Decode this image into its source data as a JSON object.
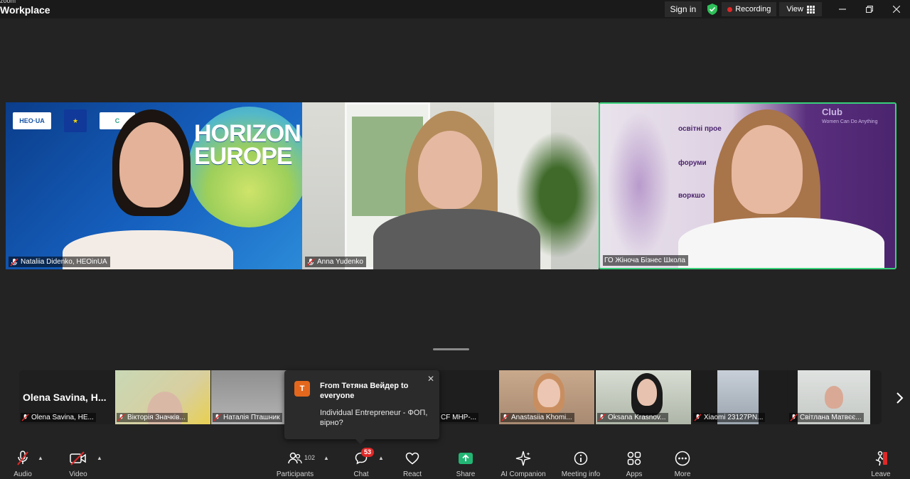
{
  "app": {
    "brand_top": "zoom",
    "brand_name": "Workplace"
  },
  "titlebar": {
    "sign_in": "Sign in",
    "recording": "Recording",
    "view": "View"
  },
  "main_tiles": [
    {
      "name": "Nataliia Didenko, HEOinUA",
      "logo_text": "HEO·UA",
      "graphic_text": "HORIZON EUROPE"
    },
    {
      "name": "Anna Yudenko"
    },
    {
      "name": "ГО Жіноча Бізнес Школа",
      "background_text": [
        "освітні прое",
        "форуми",
        "воркшо",
        "Club",
        "Women Can Do Anything"
      ]
    }
  ],
  "thumbnails": [
    {
      "name": "Olena Savina, HE...",
      "big_text": "Olena Savina, H..."
    },
    {
      "name": "Вікторія Значків..."
    },
    {
      "name": "Наталія Пташник"
    },
    {
      "name": "CF МНР-..."
    },
    {
      "name": "Anastasiia Khomi..."
    },
    {
      "name": "Oksana Krasnov..."
    },
    {
      "name": "Xiaomi 23127PN..."
    },
    {
      "name": "Світлана Матвєє..."
    }
  ],
  "chat_popup": {
    "avatar_letter": "T",
    "from": "From Тетяна Вейдер to everyone",
    "message": "Individual Entrepreneur - ФОП, вірно?"
  },
  "toolbar": {
    "audio": "Audio",
    "video": "Video",
    "participants": "Participants",
    "participants_count": "102",
    "chat": "Chat",
    "chat_badge": "53",
    "react": "React",
    "share": "Share",
    "ai_companion": "AI Companion",
    "meeting_info": "Meeting info",
    "apps": "Apps",
    "more": "More",
    "leave": "Leave"
  },
  "colors": {
    "active_speaker": "#37d17a",
    "share": "#22b573",
    "record": "#e02828",
    "leave": "#e02828"
  }
}
